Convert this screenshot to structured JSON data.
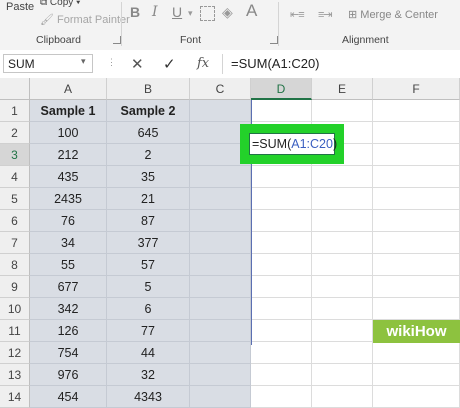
{
  "ribbon": {
    "paste_label": "Paste",
    "copy_label": "Copy",
    "copy_arrow": "▾",
    "format_painter_label": "Format Painter",
    "clipboard_label": "Clipboard",
    "font_label": "Font",
    "alignment_label": "Alignment",
    "merge_label": "Merge & Center",
    "bold": "B",
    "italic": "I",
    "underline": "U",
    "font_color_glyph": "A"
  },
  "formula_bar": {
    "name_box": "SUM",
    "cancel_glyph": "✕",
    "enter_glyph": "✓",
    "fx_label": "fx",
    "formula": "=SUM(A1:C20)"
  },
  "sheet": {
    "columns": [
      "A",
      "B",
      "C",
      "D",
      "E",
      "F"
    ],
    "rows": [
      "1",
      "2",
      "3",
      "4",
      "5",
      "6",
      "7",
      "8",
      "9",
      "10",
      "11",
      "12",
      "13",
      "14"
    ],
    "data": [
      [
        "Sample 1",
        "Sample 2"
      ],
      [
        "100",
        "645"
      ],
      [
        "212",
        "2"
      ],
      [
        "435",
        "35"
      ],
      [
        "2435",
        "21"
      ],
      [
        "76",
        "87"
      ],
      [
        "34",
        "377"
      ],
      [
        "55",
        "57"
      ],
      [
        "677",
        "5"
      ],
      [
        "342",
        "6"
      ],
      [
        "126",
        "77"
      ],
      [
        "754",
        "44"
      ],
      [
        "976",
        "32"
      ],
      [
        "454",
        "4343"
      ]
    ],
    "active_cell": {
      "prefix": "=SUM(",
      "ref": "A1:C20",
      "suffix": ")"
    }
  },
  "watermark": "wikiHow",
  "colors": {
    "accent": "#217346",
    "highlight": "#d9dde4",
    "callout": "#23d12a"
  }
}
